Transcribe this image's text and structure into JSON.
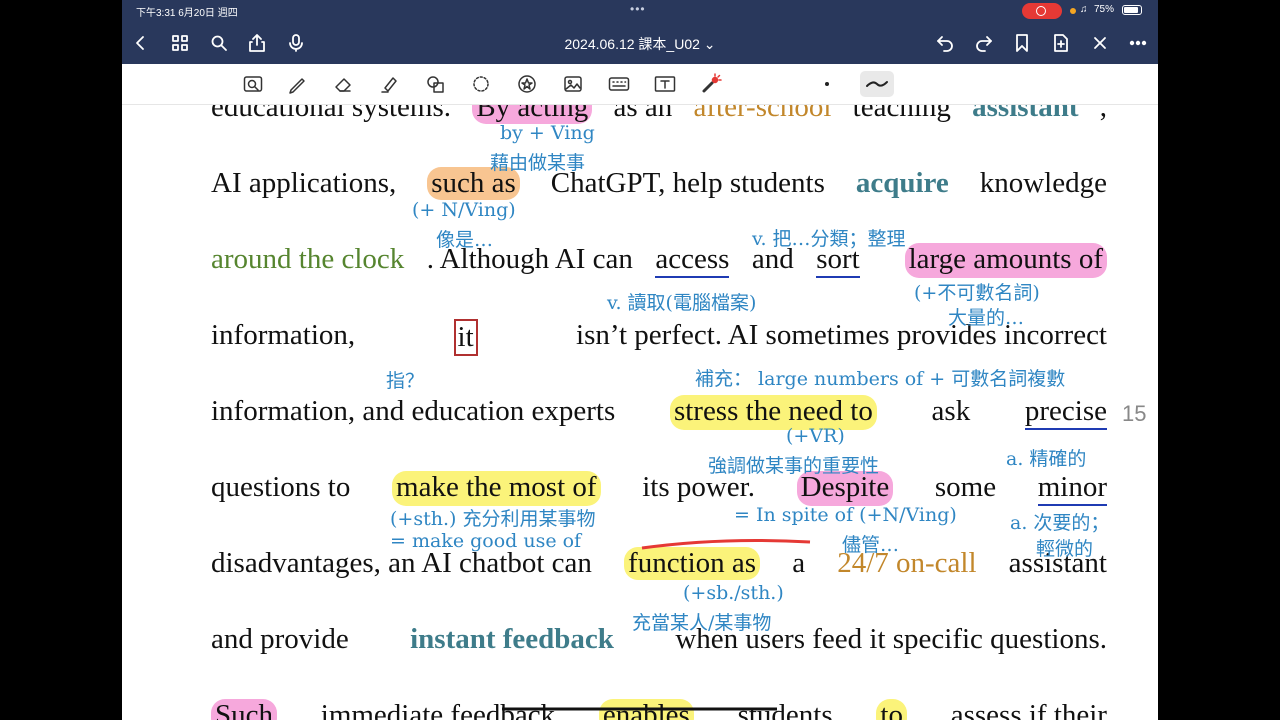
{
  "status": {
    "time": "下午3:31  6月20日 週四",
    "battery": "75%"
  },
  "nav": {
    "title": "2024.06.12 課本_U02 ⌄"
  },
  "page_number": "15",
  "lines": [
    [
      "educational systems. ",
      "By acting",
      " as an ",
      "after-school",
      " teaching ",
      "assistant",
      ","
    ],
    [
      "AI applications, ",
      "such as",
      " ChatGPT, help students ",
      "acquire",
      " knowledge"
    ],
    [
      "around the clock",
      ". Although AI can ",
      "access",
      " and ",
      "sort",
      " ",
      "large amounts of"
    ],
    [
      "information, ",
      "it",
      " isn’t perfect. AI sometimes provides incorrect"
    ],
    [
      "information, and education experts ",
      "stress the need to",
      " ask ",
      "precise"
    ],
    [
      "questions to ",
      "make the most of",
      " its power. ",
      "Despite",
      " some ",
      "minor"
    ],
    [
      "disadvantages, an AI chatbot can ",
      "function as",
      " a ",
      "24/7 on-call",
      " assistant"
    ],
    [
      "and provide ",
      "instant feedback",
      " when users feed it specific questions."
    ],
    [
      "Such",
      " immediate feedback ",
      "enables",
      " students ",
      "to",
      " assess if their"
    ]
  ],
  "annotations": [
    "by + Ving",
    "藉由做某事",
    "(+ N/Ving)",
    "像是…",
    "v. 把…分類；整理",
    "v. 讀取(電腦檔案)",
    "(+不可數名詞)",
    "大量的…",
    "指？",
    "補充： large numbers of + 可數名詞複數",
    "(+VR)",
    "強調做某事的重要性",
    "a. 精確的",
    "(+sth.) 充分利用某事物",
    "= make good use of",
    "= In spite of (+N/Ving)",
    "儘管…",
    "a. 次要的；",
    "輕微的",
    "(+sb./sth.)",
    "充當某人/某事物"
  ]
}
